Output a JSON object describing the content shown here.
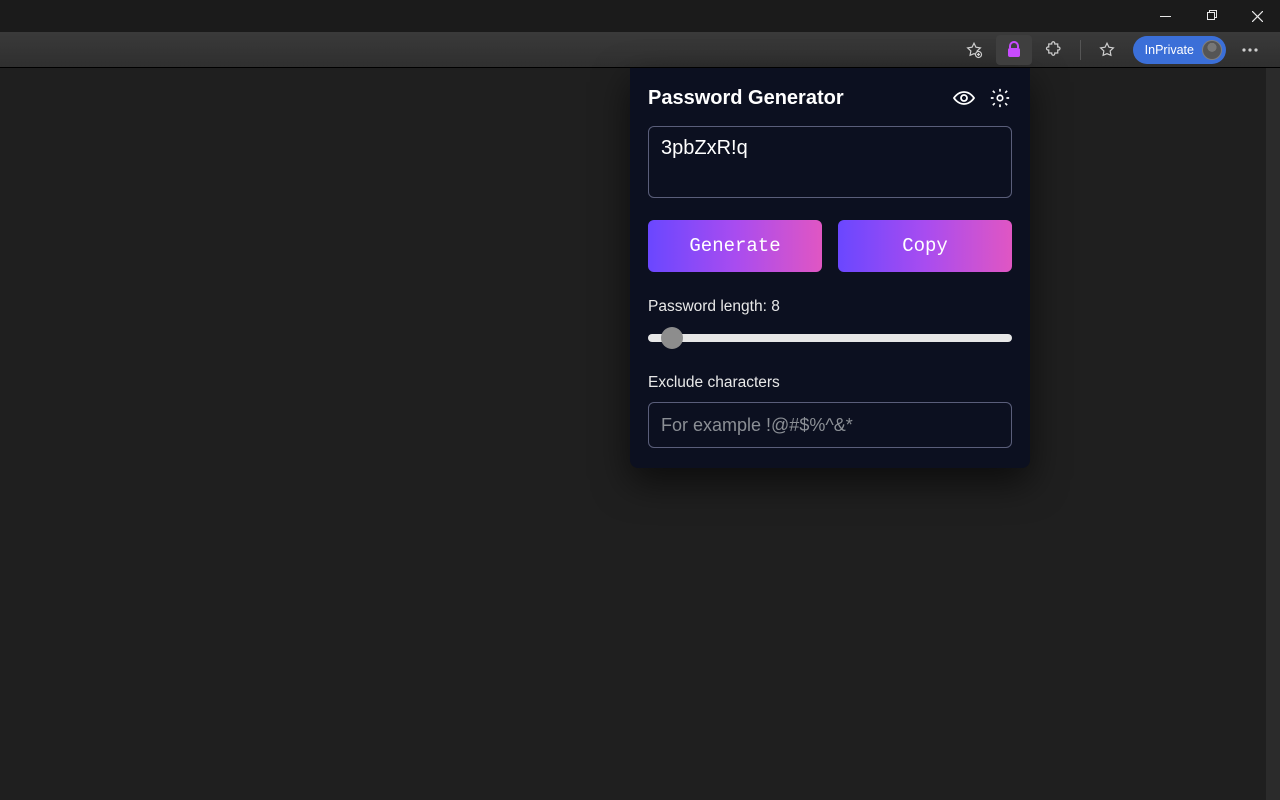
{
  "titlebar": {},
  "toolbar": {
    "inprivate_label": "InPrivate"
  },
  "popup": {
    "title": "Password Generator",
    "password_value": "3pbZxR!q",
    "generate_label": "Generate",
    "copy_label": "Copy",
    "length_label_prefix": "Password length: ",
    "length_value": 8,
    "length_min": 4,
    "length_max": 64,
    "exclude_label": "Exclude characters",
    "exclude_placeholder": "For example !@#$%^&*",
    "exclude_value": ""
  },
  "colors": {
    "panel_bg": "#0c1020",
    "gradient_start": "#6a47ff",
    "gradient_end": "#e056c3",
    "inprivate_pill": "#3b6fd8"
  }
}
